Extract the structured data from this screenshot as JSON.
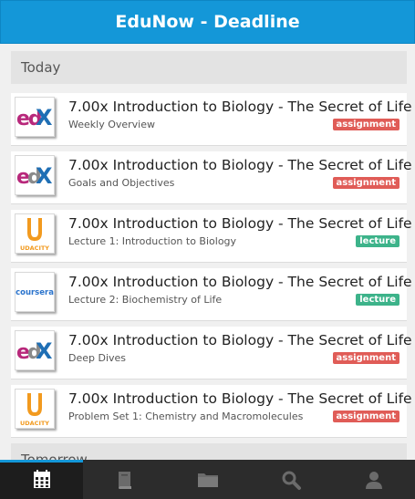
{
  "header": {
    "title": "EduNow - Deadline"
  },
  "sections": [
    {
      "label": "Today",
      "items": [
        {
          "provider": "edX",
          "title": "7.00x Introduction to Biology - The Secret of Life",
          "subtitle": "Weekly Overview",
          "tag": "assignment"
        },
        {
          "provider": "edX",
          "title": "7.00x Introduction to Biology - The Secret of Life",
          "subtitle": "Goals and Objectives",
          "tag": "assignment"
        },
        {
          "provider": "Udacity",
          "title": "7.00x Introduction to Biology - The Secret of Life",
          "subtitle": "Lecture 1: Introduction to Biology",
          "tag": "lecture"
        },
        {
          "provider": "Coursera",
          "title": "7.00x Introduction to Biology - The Secret of Life",
          "subtitle": "Lecture 2: Biochemistry of Life",
          "tag": "lecture"
        },
        {
          "provider": "edX",
          "title": "7.00x Introduction to Biology - The Secret of Life",
          "subtitle": "Deep Dives",
          "tag": "assignment"
        },
        {
          "provider": "Udacity",
          "title": "7.00x Introduction to Biology - The Secret of Life",
          "subtitle": "Problem Set 1: Chemistry and Macromolecules",
          "tag": "assignment"
        }
      ]
    },
    {
      "label": "Tomorrow",
      "items": []
    }
  ],
  "logos": {
    "udacity_text": "UDACITY",
    "coursera_text": "coursera",
    "edx_text": "edX"
  },
  "tabbar": {
    "tabs": [
      {
        "icon": "calendar-icon",
        "active": true
      },
      {
        "icon": "book-icon",
        "active": false
      },
      {
        "icon": "folder-icon",
        "active": false
      },
      {
        "icon": "search-icon",
        "active": false
      },
      {
        "icon": "user-icon",
        "active": false
      }
    ]
  },
  "colors": {
    "primary": "#1497d8",
    "assignment": "#e05c57",
    "lecture": "#3db38a",
    "tabbar": "#2c2c2c",
    "udacity": "#f29a1f",
    "edx_magenta": "#b8287b",
    "edx_blue": "#1f6fb5",
    "coursera_blue": "#2a73cc"
  }
}
